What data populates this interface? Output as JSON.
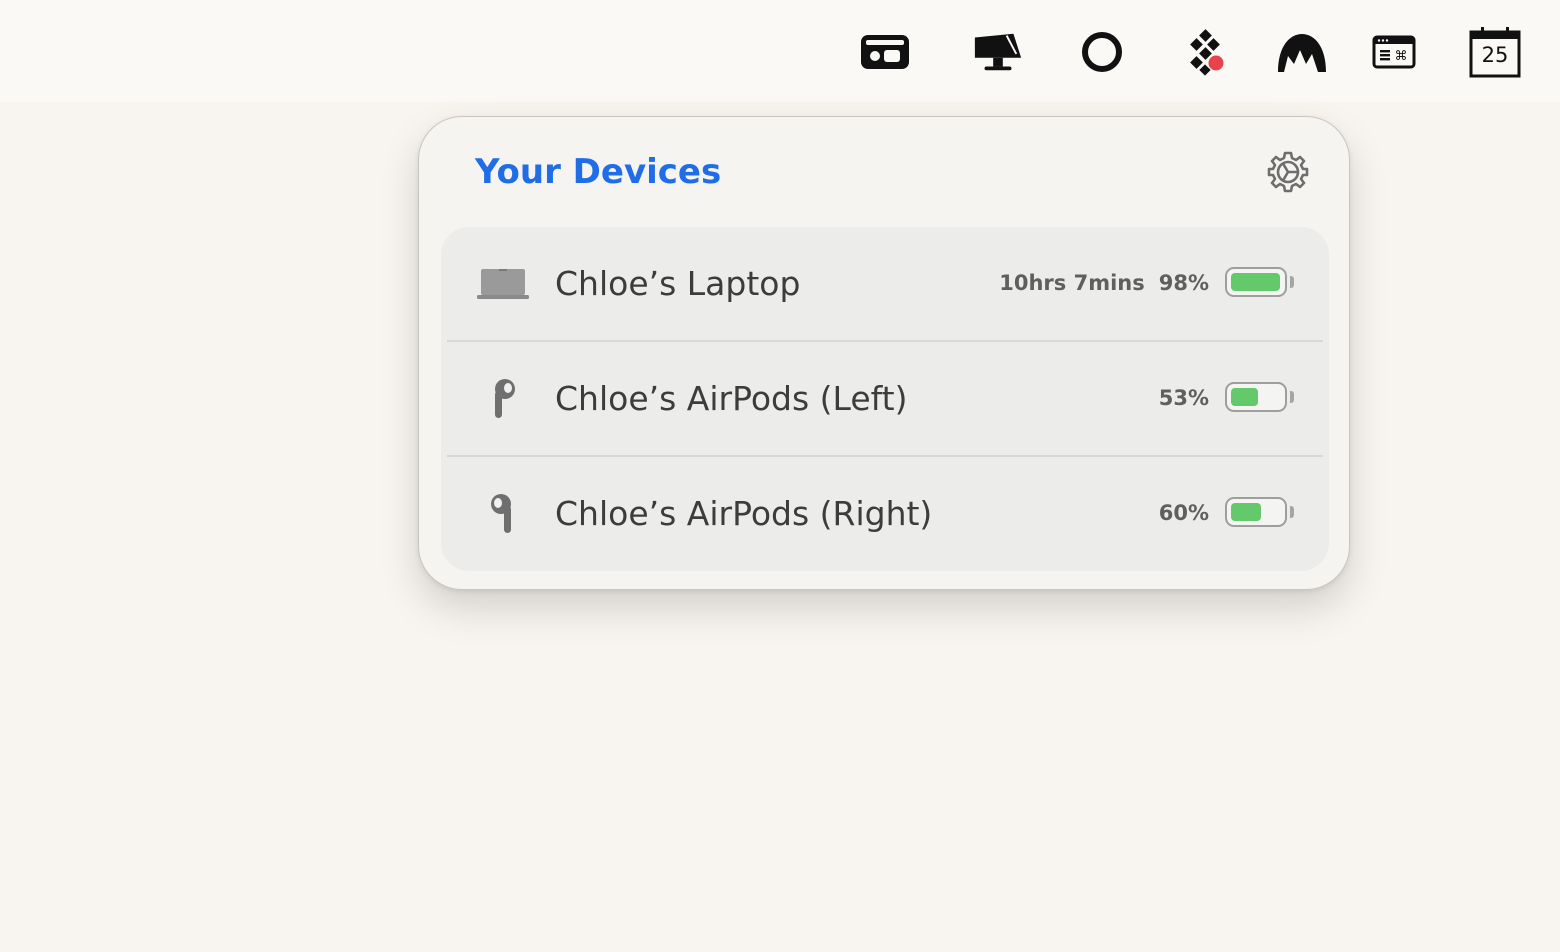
{
  "menubar": {
    "icons": [
      {
        "name": "cassette-icon"
      },
      {
        "name": "display-lamp-icon"
      },
      {
        "name": "ring-icon"
      },
      {
        "name": "dots-notification-icon",
        "badge_color": "#e8424d"
      },
      {
        "name": "mountain-icon"
      },
      {
        "name": "keyboard-shortcut-icon"
      },
      {
        "name": "calendar-icon",
        "day": "25"
      }
    ]
  },
  "popover": {
    "title": "Your Devices",
    "settings_icon": "gear-icon",
    "accent_color": "#1f6ee8",
    "devices": [
      {
        "name": "Chloe’s Laptop",
        "icon": "laptop-icon",
        "time_remaining": "10hrs 7mins",
        "battery_percent": "98%",
        "battery_level": 0.98
      },
      {
        "name": "Chloe’s AirPods (Left)",
        "icon": "airpod-left-icon",
        "battery_percent": "53%",
        "battery_level": 0.53
      },
      {
        "name": "Chloe’s AirPods (Right)",
        "icon": "airpod-right-icon",
        "battery_percent": "60%",
        "battery_level": 0.6
      }
    ],
    "battery_color": "#63c96a"
  }
}
